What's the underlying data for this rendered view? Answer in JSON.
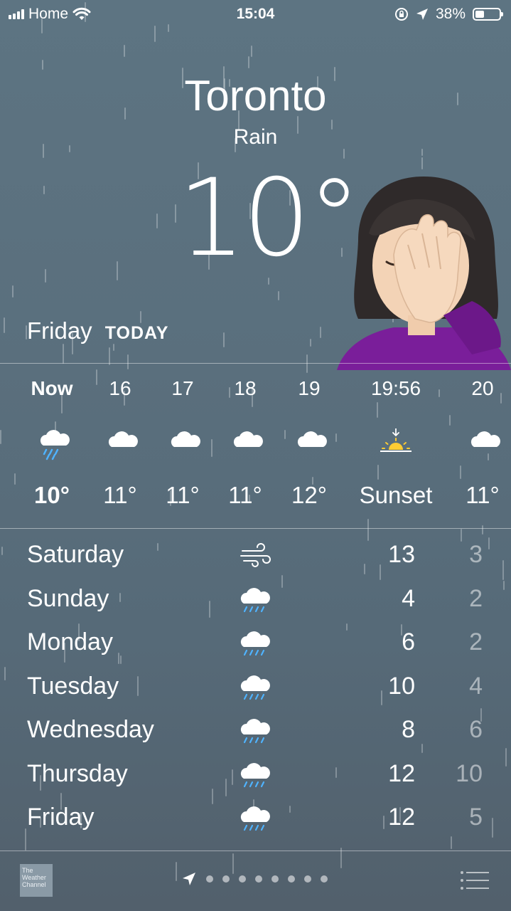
{
  "status_bar": {
    "carrier": "Home",
    "time": "15:04",
    "battery": "38%",
    "battery_level": 0.38
  },
  "header": {
    "city": "Toronto",
    "condition": "Rain",
    "temperature": "10°"
  },
  "today": {
    "day": "Friday",
    "label": "TODAY"
  },
  "hourly": [
    {
      "time": "Now",
      "icon": "rain-cloud-icon",
      "temp": "10°"
    },
    {
      "time": "16",
      "icon": "cloud-icon",
      "temp": "11°"
    },
    {
      "time": "17",
      "icon": "cloud-icon",
      "temp": "11°"
    },
    {
      "time": "18",
      "icon": "cloud-icon",
      "temp": "11°"
    },
    {
      "time": "19",
      "icon": "cloud-icon",
      "temp": "12°"
    },
    {
      "time": "19:56",
      "icon": "sunset-icon",
      "temp": "Sunset"
    },
    {
      "time": "20",
      "icon": "cloud-icon",
      "temp": "11°"
    }
  ],
  "daily": [
    {
      "day": "Saturday",
      "icon": "wind-icon",
      "high": "13",
      "low": "3"
    },
    {
      "day": "Sunday",
      "icon": "rain-cloud-icon",
      "high": "4",
      "low": "2"
    },
    {
      "day": "Monday",
      "icon": "rain-cloud-icon",
      "high": "6",
      "low": "2"
    },
    {
      "day": "Tuesday",
      "icon": "rain-cloud-icon",
      "high": "10",
      "low": "4"
    },
    {
      "day": "Wednesday",
      "icon": "rain-cloud-icon",
      "high": "8",
      "low": "6"
    },
    {
      "day": "Thursday",
      "icon": "rain-cloud-icon",
      "high": "12",
      "low": "10"
    },
    {
      "day": "Friday",
      "icon": "rain-cloud-icon",
      "high": "12",
      "low": "5"
    }
  ],
  "bottom": {
    "logo_text": "The Weather Channel",
    "page_dots": 8
  }
}
